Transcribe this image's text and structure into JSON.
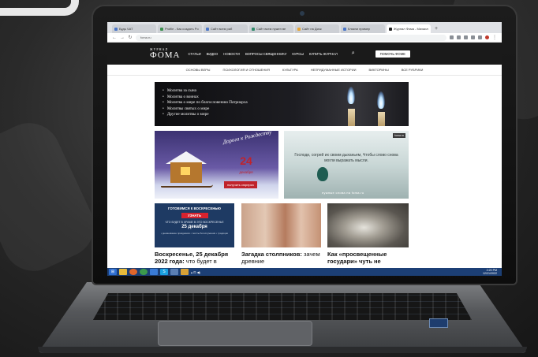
{
  "browser": {
    "tabs": [
      {
        "label": "Будь ЧАТ"
      },
      {
        "label": "Profile - Как создать Po"
      },
      {
        "label": "Сайт всем раб"
      },
      {
        "label": "Сайт всем нужен ве"
      },
      {
        "label": "Сайт на Диск"
      },
      {
        "label": "Кликни пример"
      },
      {
        "label": "Журнал Фома - Михаил"
      }
    ],
    "url": "foma.ru"
  },
  "site": {
    "logo_top": "ЖУРНАЛ",
    "logo_main": "ФОМА",
    "menu": [
      "СТАТЬИ",
      "ВИДЕО",
      "НОВОСТИ",
      "ВОПРОСЫ СВЯЩЕННИКУ",
      "КУРСЫ",
      "КУПИТЬ ЖУРНАЛ"
    ],
    "help_button": "ПОМОЧЬ ФОМЕ",
    "subnav": [
      "ОСНОВЫ ВЕРЫ",
      "ПСИХОЛОГИЯ И ОТНОШЕНИЯ",
      "КУЛЬТУРА",
      "НЕПРИДУМАННЫЕ ИСТОРИИ",
      "ВИКТОРИНЫ",
      "ВСЕ РУБРИКИ"
    ]
  },
  "hero": {
    "items": [
      "Молитва за сына",
      "Молитва о воинах",
      "Молитва о мире по благословению Патриарха",
      "Молитвы святых о мире",
      "Другие молитвы о мире"
    ]
  },
  "advent_card": {
    "title": "Дорога к Рождеству",
    "date": "24",
    "month": "декабря",
    "button": "получить сюрприз"
  },
  "quote_card": {
    "text": "Господи, согрей их своим дыханьем, Чтобы слово снова могли выражать мысли.",
    "caption": "нужные слова на foma.ru",
    "tag": "foma.ru"
  },
  "sunday_card": {
    "heading": "ГОТОВИМСЯ К ВОСКРЕСЕНЬЮ",
    "button": "УЗНАТЬ",
    "subheading": "ЧТО БУДЕТ В ХРАМЕ В ЭТО ВОСКРЕСЕНЬЕ",
    "date": "25 декабря",
    "details": "• дневнование праздников • тексты богослужения • традиции"
  },
  "articles": [
    {
      "bold": "Воскресенье, 25 декабря 2022 года:",
      "rest": " что будет в"
    },
    {
      "bold": "Загадка столпников:",
      "rest": " зачем древние"
    },
    {
      "bold": "Как «просвещенные государи» чуть не",
      "rest": ""
    }
  ],
  "taskbar": {
    "time": "2:20 PM",
    "date": "12/21/2022"
  }
}
